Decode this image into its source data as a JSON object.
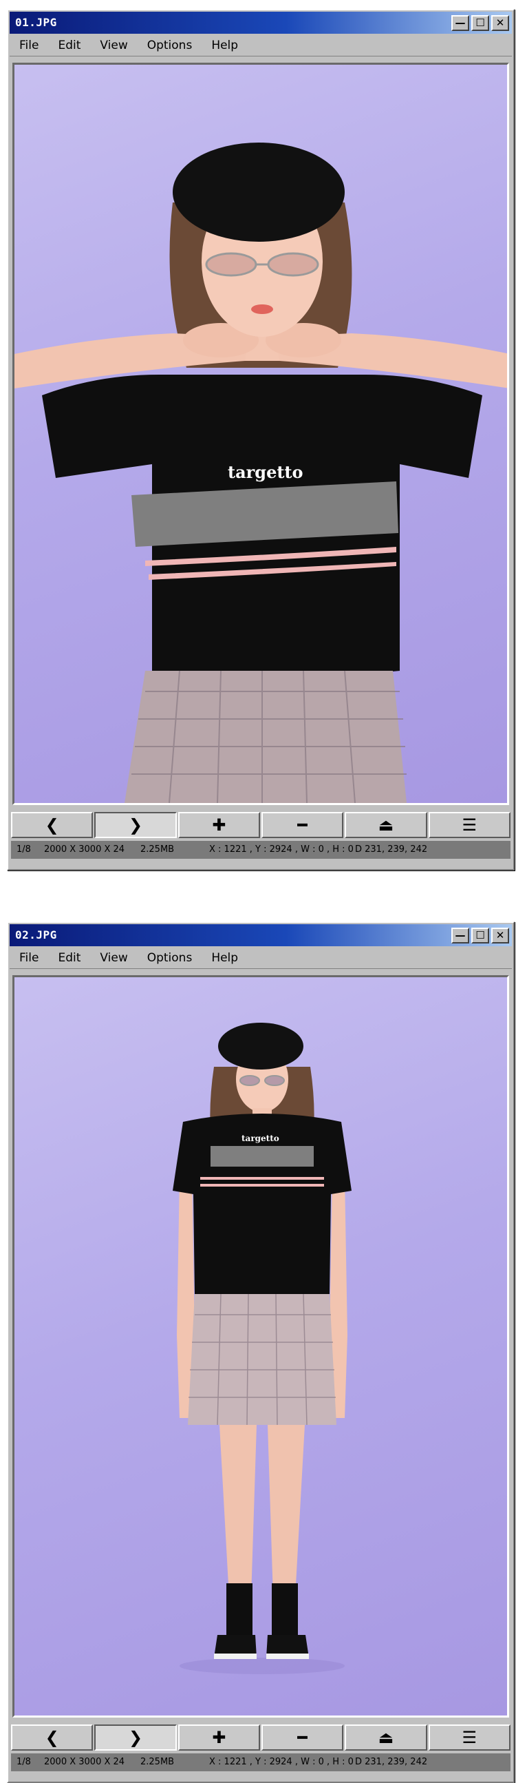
{
  "windows": [
    {
      "title": "01.JPG",
      "menu": [
        "File",
        "Edit",
        "View",
        "Options",
        "Help"
      ],
      "window_buttons": {
        "minimize": "—",
        "maximize": "☐",
        "close": "✕"
      },
      "photo": {
        "logo_text": "targetto",
        "subject": "close-up"
      },
      "toolbar": {
        "prev": "❮",
        "next": "❯",
        "zoom_in": "✚",
        "zoom_out": "━",
        "eject": "⏏",
        "menu": "☰"
      },
      "status": {
        "page": "1/8",
        "dims": "2000 X 3000 X 24",
        "size": "2.25MB",
        "coords": "X : 1221 , Y : 2924 , W : 0 , H : 0",
        "color": "D 231, 239, 242"
      }
    },
    {
      "title": "02.JPG",
      "menu": [
        "File",
        "Edit",
        "View",
        "Options",
        "Help"
      ],
      "window_buttons": {
        "minimize": "—",
        "maximize": "☐",
        "close": "✕"
      },
      "photo": {
        "logo_text": "targetto",
        "subject": "full-body"
      },
      "toolbar": {
        "prev": "❮",
        "next": "❯",
        "zoom_in": "✚",
        "zoom_out": "━",
        "eject": "⏏",
        "menu": "☰"
      },
      "status": {
        "page": "1/8",
        "dims": "2000 X 3000 X 24",
        "size": "2.25MB",
        "coords": "X : 1221 , Y : 2924 , W : 0 , H : 0",
        "color": "D 231, 239, 242"
      }
    }
  ],
  "colors": {
    "title_bar_start": "#0a1a78",
    "title_bar_end": "#a8c8f0",
    "window_face": "#c0c0c0",
    "backdrop": "#b4a9ea",
    "status_bg": "#7a7a7a"
  }
}
